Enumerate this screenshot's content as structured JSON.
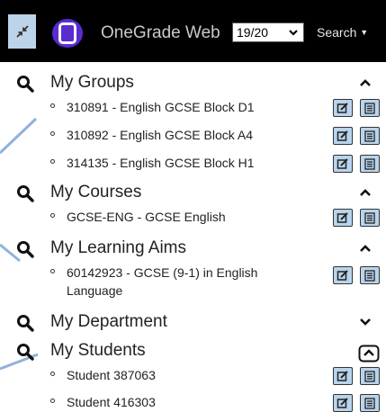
{
  "header": {
    "app_title": "OneGrade Web",
    "term_value": "19/20",
    "search_label": "Search"
  },
  "icons": {
    "pin": "collapse-arrows-icon",
    "logo": "onegrade-logo",
    "search": "magnifier-icon",
    "edit": "edit-icon",
    "list": "list-icon"
  },
  "colors": {
    "topbar": "#000000",
    "logo": "#5b2ad1",
    "button": "#b9d4ec",
    "decor_line": "#8fb3d9"
  },
  "sections": [
    {
      "key": "groups",
      "title": "My Groups",
      "expanded": true,
      "items": [
        "310891 - English GCSE Block D1",
        "310892 - English GCSE Block A4",
        "314135 - English GCSE Block H1"
      ]
    },
    {
      "key": "courses",
      "title": "My Courses",
      "expanded": true,
      "items": [
        "GCSE-ENG - GCSE English"
      ]
    },
    {
      "key": "aims",
      "title": "My Learning Aims",
      "expanded": true,
      "items": [
        "60142923 - GCSE (9-1) in English Language"
      ]
    },
    {
      "key": "department",
      "title": "My Department",
      "expanded": false,
      "items": []
    },
    {
      "key": "students",
      "title": "My Students",
      "expanded": true,
      "items": [
        "Student 387063",
        "Student 416303"
      ]
    }
  ]
}
